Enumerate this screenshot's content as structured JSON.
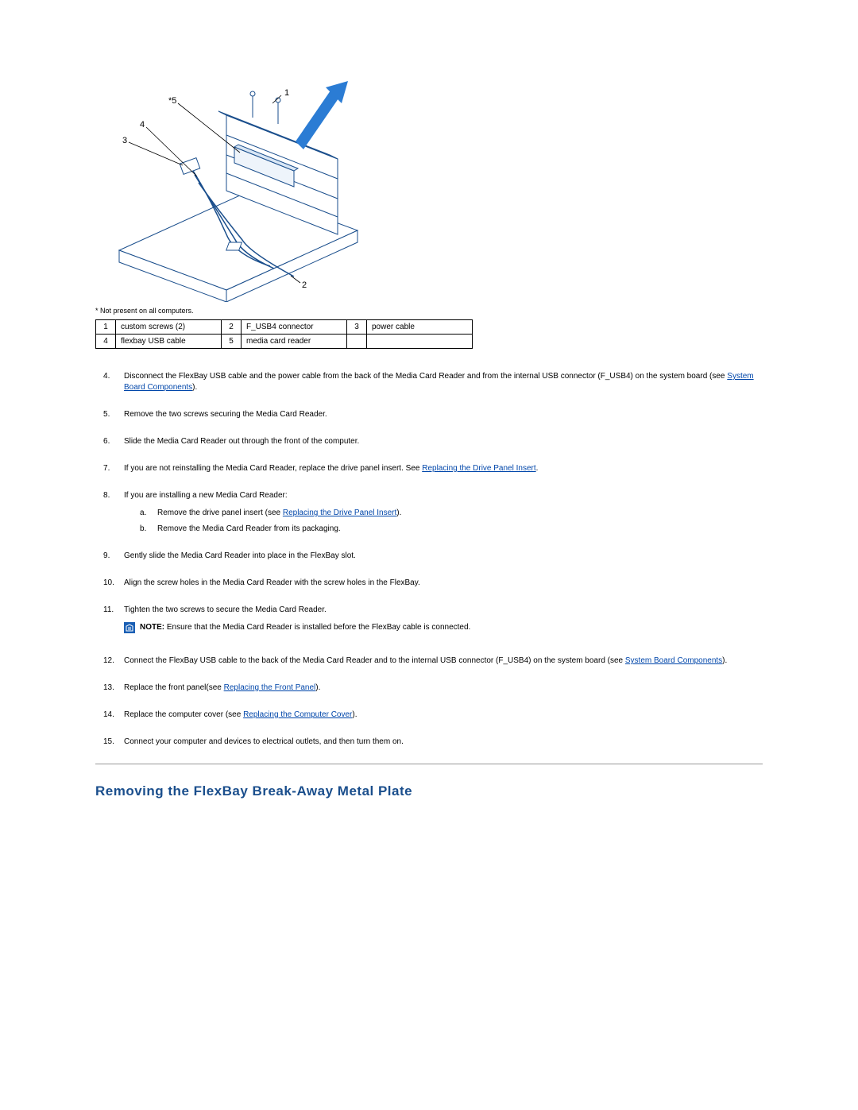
{
  "diagram": {
    "callouts": [
      "1",
      "2",
      "3",
      "4",
      "*5"
    ],
    "footnote": "* Not present on all computers."
  },
  "legend": {
    "rows": [
      {
        "n1": "1",
        "l1": "custom screws (2)",
        "n2": "2",
        "l2": "F_USB4 connector",
        "n3": "3",
        "l3": "power cable"
      },
      {
        "n1": "4",
        "l1": "flexbay USB cable",
        "n2": "5",
        "l2": "media card reader",
        "n3": "",
        "l3": ""
      }
    ]
  },
  "steps": {
    "s4a": "Disconnect the FlexBay USB cable and the power cable from the back of the Media Card Reader and from the internal USB connector (F_USB4) on the system board (see ",
    "s4link": "System Board Components",
    "s4b": ").",
    "s5": "Remove the two screws securing the Media Card Reader.",
    "s6": "Slide the Media Card Reader out through the front of the computer.",
    "s7a": "If you are not reinstalling the Media Card Reader, replace the drive panel insert. See ",
    "s7link": "Replacing the Drive Panel Insert",
    "s7b": ".",
    "s8": "If you are installing a new Media Card Reader:",
    "s8a_a": "Remove the drive panel insert (see ",
    "s8a_link": "Replacing the Drive Panel Insert",
    "s8a_b": ").",
    "s8b": "Remove the Media Card Reader from its packaging.",
    "s9": "Gently slide the Media Card Reader into place in the FlexBay slot.",
    "s10": "Align the screw holes in the Media Card Reader with the screw holes in the FlexBay.",
    "s11": "Tighten the two screws to secure the Media Card Reader.",
    "note_label": "NOTE:",
    "note_text": " Ensure that the Media Card Reader is installed before the FlexBay cable is connected.",
    "s12a": "Connect the FlexBay USB cable to the back of the Media Card Reader and to the internal USB connector (F_USB4) on the system board (see ",
    "s12link": "System Board Components",
    "s12b": ").",
    "s13a": "Replace the front panel(see ",
    "s13link": "Replacing the Front Panel",
    "s13b": ").",
    "s14a": "Replace the computer cover (see ",
    "s14link": "Replacing the Computer Cover",
    "s14b": ").",
    "s15": "Connect your computer and devices to electrical outlets, and then turn them on."
  },
  "section_heading": "Removing the FlexBay Break-Away Metal Plate"
}
